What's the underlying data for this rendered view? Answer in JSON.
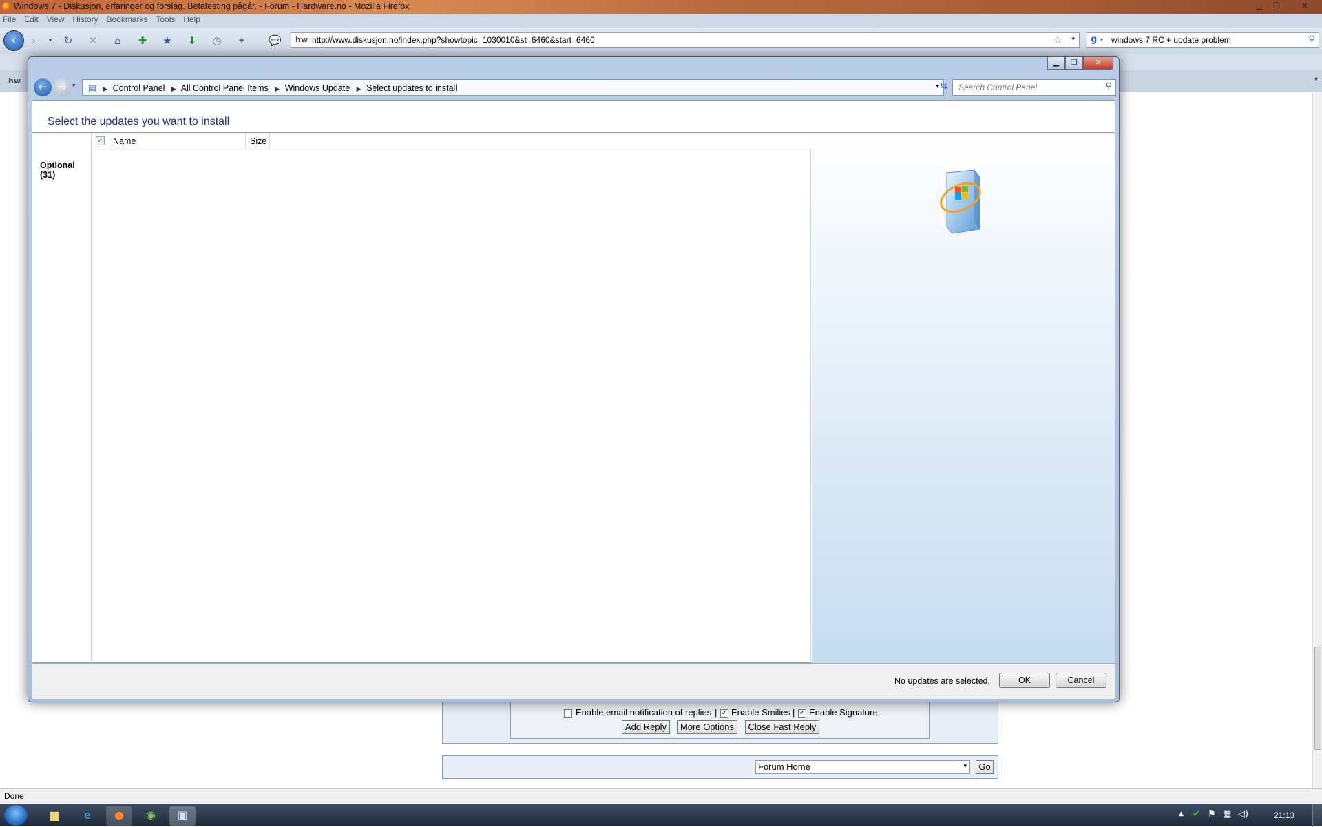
{
  "firefox": {
    "window_title": "Windows 7 - Diskusjon, erfaringer og forslag. Betatesting pågår. - Forum - Hardware.no - Mozilla Firefox",
    "menu": [
      "File",
      "Edit",
      "View",
      "History",
      "Bookmarks",
      "Tools",
      "Help"
    ],
    "url": "http://www.diskusjon.no/index.php?showtopic=1030010&st=6460&start=6460",
    "site_badge": "hw",
    "search_value": "windows 7 RC + update problem",
    "status": "Done"
  },
  "forum": {
    "opt_email": "Enable email notification of replies",
    "sep": "|",
    "opt_smilies": "Enable Smilies",
    "opt_signature": "Enable Signature",
    "add_reply": "Add Reply",
    "more_options": "More Options",
    "close_fast_reply": "Close Fast Reply",
    "jump_value": "Forum Home",
    "go": "Go"
  },
  "dialog": {
    "breadcrumbs": [
      "Control Panel",
      "All Control Panel Items",
      "Windows Update",
      "Select updates to install"
    ],
    "search_placeholder": "Search Control Panel",
    "heading": "Select the updates you want to install",
    "category": "Optional (31)",
    "col_name": "Name",
    "col_size": "Size",
    "status": "No updates are selected.",
    "ok": "OK",
    "cancel": "Cancel"
  },
  "taskbar": {
    "clock": "21:13"
  }
}
